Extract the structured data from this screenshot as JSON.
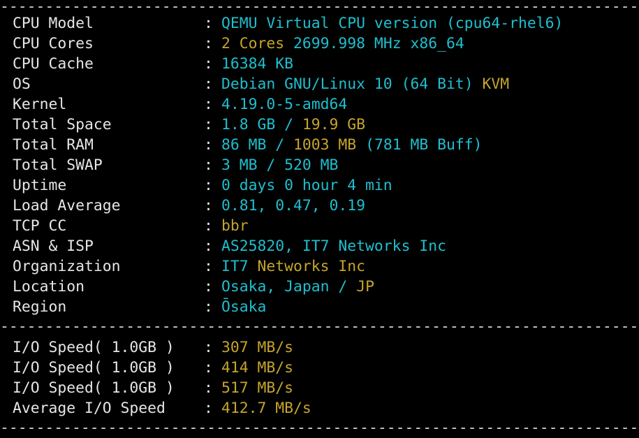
{
  "separator": "------------------------------------------------------------------------------------------",
  "colors": {
    "background": "#000000",
    "label": "#e6e6e6",
    "cyan": "#1fbfcf",
    "yellow": "#c6a52a"
  },
  "system_info": [
    {
      "label": "CPU Model",
      "value": [
        {
          "text": "QEMU Virtual CPU version (cpu64-rhel6)",
          "color": "cyan"
        }
      ]
    },
    {
      "label": "CPU Cores",
      "value": [
        {
          "text": "2 Cores ",
          "color": "yellow"
        },
        {
          "text": "2699.998 MHz x86_64",
          "color": "cyan"
        }
      ]
    },
    {
      "label": "CPU Cache",
      "value": [
        {
          "text": "16384 KB",
          "color": "cyan"
        }
      ]
    },
    {
      "label": "OS",
      "value": [
        {
          "text": "Debian GNU/Linux 10 (64 Bit) ",
          "color": "cyan"
        },
        {
          "text": "KVM",
          "color": "yellow"
        }
      ]
    },
    {
      "label": "Kernel",
      "value": [
        {
          "text": "4.19.0-5-amd64",
          "color": "cyan"
        }
      ]
    },
    {
      "label": "Total Space",
      "value": [
        {
          "text": "1.8 GB / ",
          "color": "cyan"
        },
        {
          "text": "19.9 GB",
          "color": "yellow"
        }
      ]
    },
    {
      "label": "Total RAM",
      "value": [
        {
          "text": "86 MB / ",
          "color": "cyan"
        },
        {
          "text": "1003 MB ",
          "color": "yellow"
        },
        {
          "text": "(781 MB Buff)",
          "color": "cyan"
        }
      ]
    },
    {
      "label": "Total SWAP",
      "value": [
        {
          "text": "3 MB / 520 MB",
          "color": "cyan"
        }
      ]
    },
    {
      "label": "Uptime",
      "value": [
        {
          "text": "0 days 0 hour 4 min",
          "color": "cyan"
        }
      ]
    },
    {
      "label": "Load Average",
      "value": [
        {
          "text": "0.81, 0.47, 0.19",
          "color": "cyan"
        }
      ]
    },
    {
      "label": "TCP CC",
      "value": [
        {
          "text": "bbr",
          "color": "yellow"
        }
      ]
    },
    {
      "label": "ASN & ISP",
      "value": [
        {
          "text": "AS25820, IT7 Networks Inc",
          "color": "cyan"
        }
      ]
    },
    {
      "label": "Organization",
      "value": [
        {
          "text": "IT7 ",
          "color": "cyan"
        },
        {
          "text": "Networks Inc",
          "color": "yellow"
        }
      ]
    },
    {
      "label": "Location",
      "value": [
        {
          "text": "Osaka, Japan / ",
          "color": "cyan"
        },
        {
          "text": "JP",
          "color": "yellow"
        }
      ]
    },
    {
      "label": "Region",
      "value": [
        {
          "text": "Ōsaka",
          "color": "cyan"
        }
      ]
    }
  ],
  "io_info": [
    {
      "label": "I/O Speed( 1.0GB )",
      "value": [
        {
          "text": "307 MB/s",
          "color": "yellow"
        }
      ]
    },
    {
      "label": "I/O Speed( 1.0GB )",
      "value": [
        {
          "text": "414 MB/s",
          "color": "yellow"
        }
      ]
    },
    {
      "label": "I/O Speed( 1.0GB )",
      "value": [
        {
          "text": "517 MB/s",
          "color": "yellow"
        }
      ]
    },
    {
      "label": "Average I/O Speed",
      "value": [
        {
          "text": "412.7 MB/s",
          "color": "yellow"
        }
      ]
    }
  ],
  "colon": ":"
}
